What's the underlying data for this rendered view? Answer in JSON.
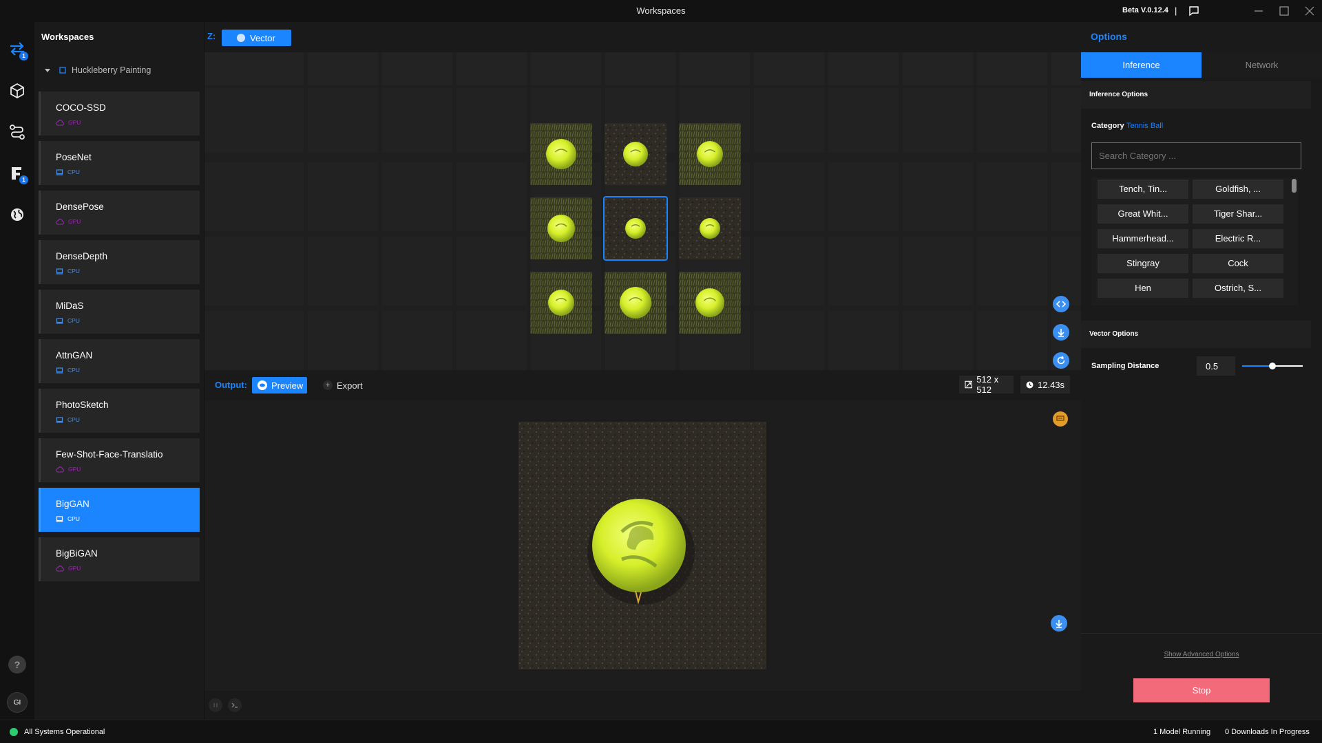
{
  "titlebar": {
    "title": "Workspaces",
    "version": "Beta V.0.12.4",
    "separator": "|"
  },
  "rail": {
    "badges": [
      "1",
      "1"
    ],
    "help": "?",
    "avatar": "GI"
  },
  "workspaces": {
    "title": "Workspaces",
    "project": "Huckleberry Painting",
    "models": [
      {
        "name": "COCO-SSD",
        "device": "GPU"
      },
      {
        "name": "PoseNet",
        "device": "CPU"
      },
      {
        "name": "DensePose",
        "device": "GPU"
      },
      {
        "name": "DenseDepth",
        "device": "CPU"
      },
      {
        "name": "MiDaS",
        "device": "CPU"
      },
      {
        "name": "AttnGAN",
        "device": "CPU"
      },
      {
        "name": "PhotoSketch",
        "device": "CPU"
      },
      {
        "name": "Few-Shot-Face-Translatio",
        "device": "GPU"
      },
      {
        "name": "BigGAN",
        "device": "CPU",
        "active": true
      },
      {
        "name": "BigBiGAN",
        "device": "GPU"
      }
    ]
  },
  "input": {
    "label": "Z:",
    "tab_label": "Vector",
    "selected_index": 4
  },
  "output": {
    "label": "Output:",
    "preview_label": "Preview",
    "export_label": "Export",
    "resolution": "512 x 512",
    "time": "12.43s"
  },
  "options": {
    "title": "Options",
    "tabs": [
      "Inference",
      "Network"
    ],
    "active_tab": "Inference",
    "inference_section": "Inference Options",
    "category_label": "Category",
    "category_value": "Tennis Ball",
    "search_placeholder": "Search Category ...",
    "categories": [
      "Tench, Tin...",
      "Goldfish, ...",
      "Great Whit...",
      "Tiger Shar...",
      "Hammerhead...",
      "Electric R...",
      "Stingray",
      "Cock",
      "Hen",
      "Ostrich, S..."
    ],
    "vector_section": "Vector Options",
    "sampling_label": "Sampling Distance",
    "sampling_value": "0.5",
    "sampling_fraction": 0.5,
    "advanced_link": "Show Advanced Options",
    "stop_label": "Stop"
  },
  "status": {
    "system": "All Systems Operational",
    "models_running": "1 Model Running",
    "downloads": "0 Downloads In Progress"
  },
  "colors": {
    "accent": "#1a85ff",
    "stop": "#f36b7a",
    "gpu": "#9c27b0",
    "cpu": "#4d8fe0",
    "ok": "#2ecc71"
  }
}
